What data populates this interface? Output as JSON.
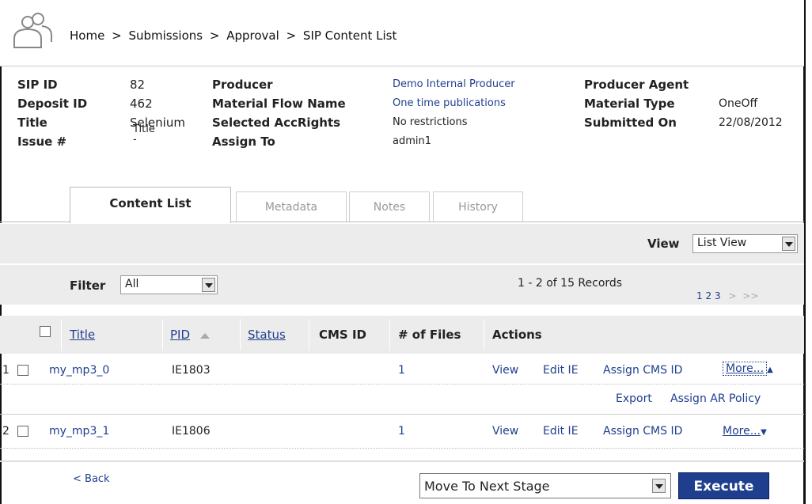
{
  "breadcrumb": {
    "items": [
      "Home",
      "Submissions",
      "Approval",
      "SIP Content List"
    ],
    "separator": ">"
  },
  "info": {
    "sip_id_label": "SIP ID",
    "sip_id": "82",
    "deposit_id_label": "Deposit ID",
    "deposit_id": "462",
    "title_label": "Title",
    "title_line1": "Selenium",
    "title_line2": "Title",
    "issue_label": "Issue #",
    "issue": "-",
    "producer_label": "Producer",
    "producer": "Demo Internal Producer",
    "material_flow_label": "Material Flow Name",
    "material_flow": "One time publications",
    "acc_rights_label": "Selected AccRights",
    "acc_rights": "No restrictions",
    "assign_to_label": "Assign To",
    "assign_to": "admin1",
    "producer_agent_label": "Producer Agent",
    "material_type_label": "Material Type",
    "material_type": "OneOff",
    "submitted_on_label": "Submitted On",
    "submitted_on": "22/08/2012"
  },
  "tabs": [
    {
      "label": "Content List",
      "active": true
    },
    {
      "label": "Metadata",
      "active": false
    },
    {
      "label": "Notes",
      "active": false
    },
    {
      "label": "History",
      "active": false
    }
  ],
  "view": {
    "label": "View",
    "value": "List View"
  },
  "filter": {
    "label": "Filter",
    "value": "All"
  },
  "pagination": {
    "records": "1 - 2 of 15 Records",
    "pages": [
      "1",
      "2",
      "3"
    ],
    "next": ">",
    "last": ">>"
  },
  "table": {
    "headers": {
      "title": "Title",
      "pid": "PID",
      "status": "Status",
      "cms_id": "CMS ID",
      "num_files": "# of Files",
      "actions": "Actions"
    },
    "rows": [
      {
        "index": "1",
        "title": "my_mp3_0",
        "pid": "IE1803",
        "status": "",
        "cms_id": "",
        "num_files": "1",
        "view": "View",
        "edit": "Edit IE",
        "assign": "Assign CMS ID",
        "more": "More...",
        "more_state": "expanded",
        "extra_actions": [
          "Export",
          "Assign AR Policy"
        ]
      },
      {
        "index": "2",
        "title": "my_mp3_1",
        "pid": "IE1806",
        "status": "",
        "cms_id": "",
        "num_files": "1",
        "view": "View",
        "edit": "Edit IE",
        "assign": "Assign CMS ID",
        "more": "More...",
        "more_state": "collapsed"
      }
    ]
  },
  "footer": {
    "back": "< Back",
    "stage_select": "Move To Next Stage",
    "execute": "Execute"
  },
  "colors": {
    "link": "#1f3f8e",
    "execute_bg": "#1f3f8e",
    "band_gray": "#ececec"
  },
  "icons": {
    "user": "users-icon",
    "sort": "sort-ascending-icon"
  }
}
